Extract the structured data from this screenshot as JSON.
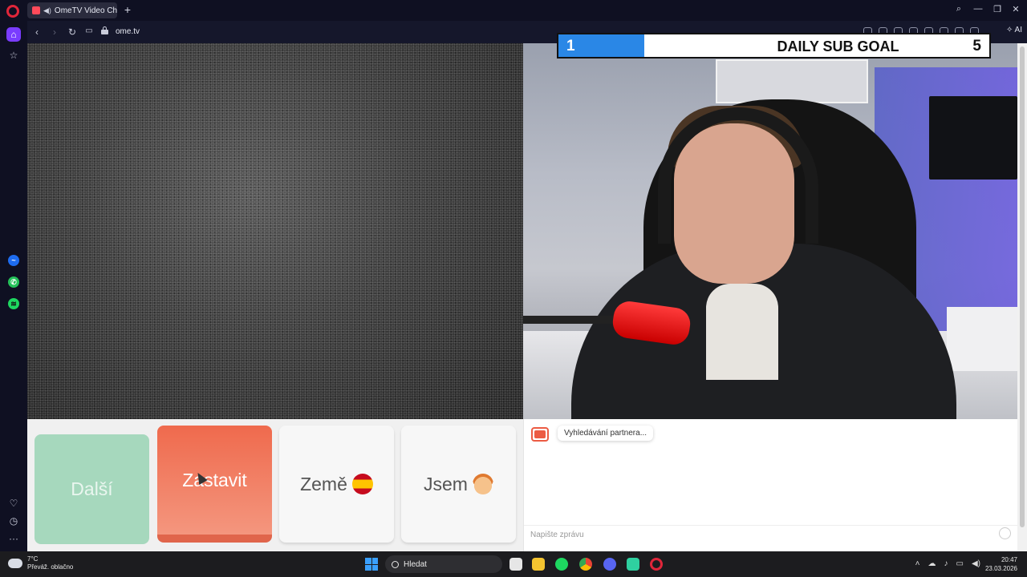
{
  "browser": {
    "tab_title": "OmeTV Video Chat -",
    "new_tab_symbol": "+",
    "url": "ome.tv",
    "ai_label": "AI"
  },
  "overlay": {
    "goal_current": "1",
    "goal_title": "DAILY SUB GOAL",
    "goal_target": "5",
    "goal_progress": 0.2
  },
  "controls": {
    "next_label": "Další",
    "stop_label": "Zastavit",
    "country_label": "Země",
    "gender_label": "Jsem"
  },
  "chat": {
    "status_message": "Vyhledávání partnera...",
    "input_placeholder": "Napište zprávu"
  },
  "taskbar": {
    "temperature": "7°C",
    "weather_desc": "Převáž. oblačno",
    "search_label": "Hledat",
    "time": "20:47",
    "date": "23.03.2026"
  },
  "colors": {
    "accent_purple": "#7a3cff",
    "stop_orange": "#ef6a4d",
    "next_green": "#a6d8bd",
    "goal_blue": "#2a87e6"
  },
  "icons": [
    "opera-logo-icon",
    "speaker-icon",
    "back-icon",
    "forward-icon",
    "reload-icon",
    "lock-icon",
    "home-icon",
    "star-icon",
    "messenger-icon",
    "whatsapp-icon",
    "spotify-icon",
    "heart-icon",
    "history-icon",
    "more-icon",
    "search-icon",
    "minimize-icon",
    "maximize-icon",
    "close-icon",
    "emoji-icon",
    "windows-start-icon"
  ]
}
